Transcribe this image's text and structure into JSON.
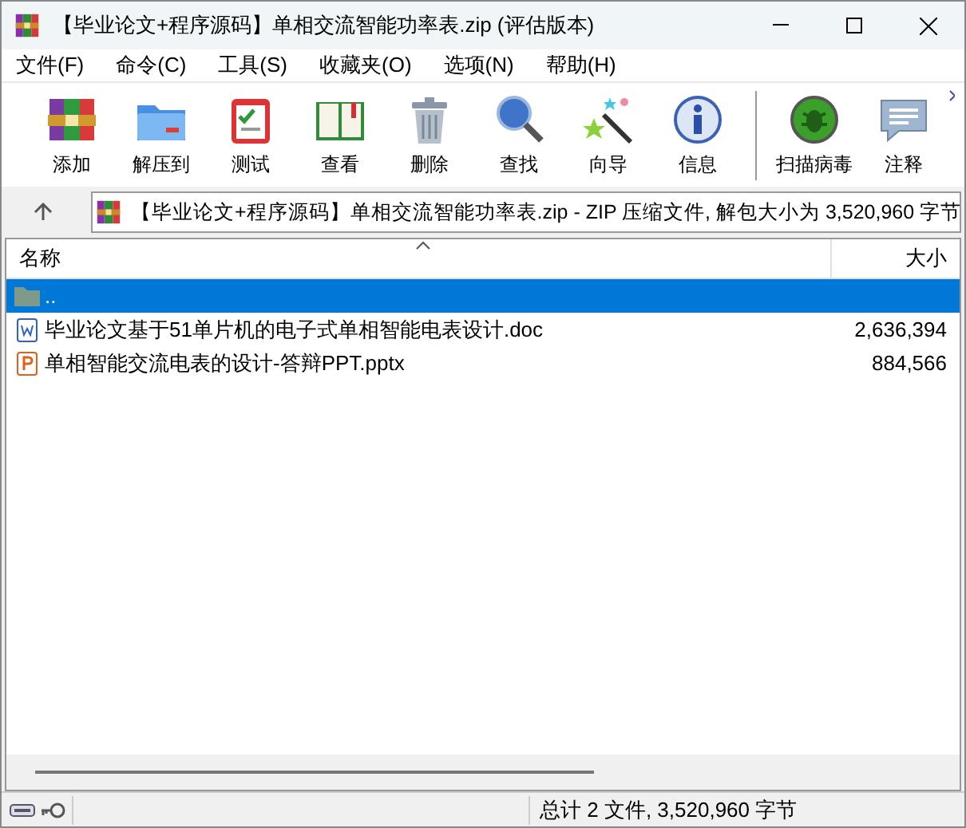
{
  "window": {
    "title": "【毕业论文+程序源码】单相交流智能功率表.zip (评估版本)"
  },
  "menu": [
    "文件(F)",
    "命令(C)",
    "工具(S)",
    "收藏夹(O)",
    "选项(N)",
    "帮助(H)"
  ],
  "toolbar": [
    {
      "kind": "add",
      "label": "添加"
    },
    {
      "kind": "extract",
      "label": "解压到"
    },
    {
      "kind": "test",
      "label": "测试"
    },
    {
      "kind": "view",
      "label": "查看"
    },
    {
      "kind": "delete",
      "label": "删除"
    },
    {
      "kind": "find",
      "label": "查找"
    },
    {
      "kind": "wizard",
      "label": "向导"
    },
    {
      "kind": "info",
      "label": "信息"
    },
    {
      "kind": "scan",
      "label": "扫描病毒"
    },
    {
      "kind": "comment",
      "label": "注释"
    }
  ],
  "address": {
    "value": "【毕业论文+程序源码】单相交流智能功率表.zip - ZIP 压缩文件, 解包大小为 3,520,960 字节"
  },
  "table": {
    "columns": [
      "名称",
      "大小"
    ],
    "rows": [
      {
        "kind": "parent",
        "name": "..",
        "size": "",
        "selected": true
      },
      {
        "kind": "doc",
        "name": "毕业论文基于51单片机的电子式单相智能电表设计.doc",
        "size": "2,636,394",
        "selected": false
      },
      {
        "kind": "ppt",
        "name": "单相智能交流电表的设计-答辩PPT.pptx",
        "size": "884,566",
        "selected": false
      }
    ]
  },
  "status_bar": {
    "text": "总计 2 文件, 3,520,960 字节"
  }
}
